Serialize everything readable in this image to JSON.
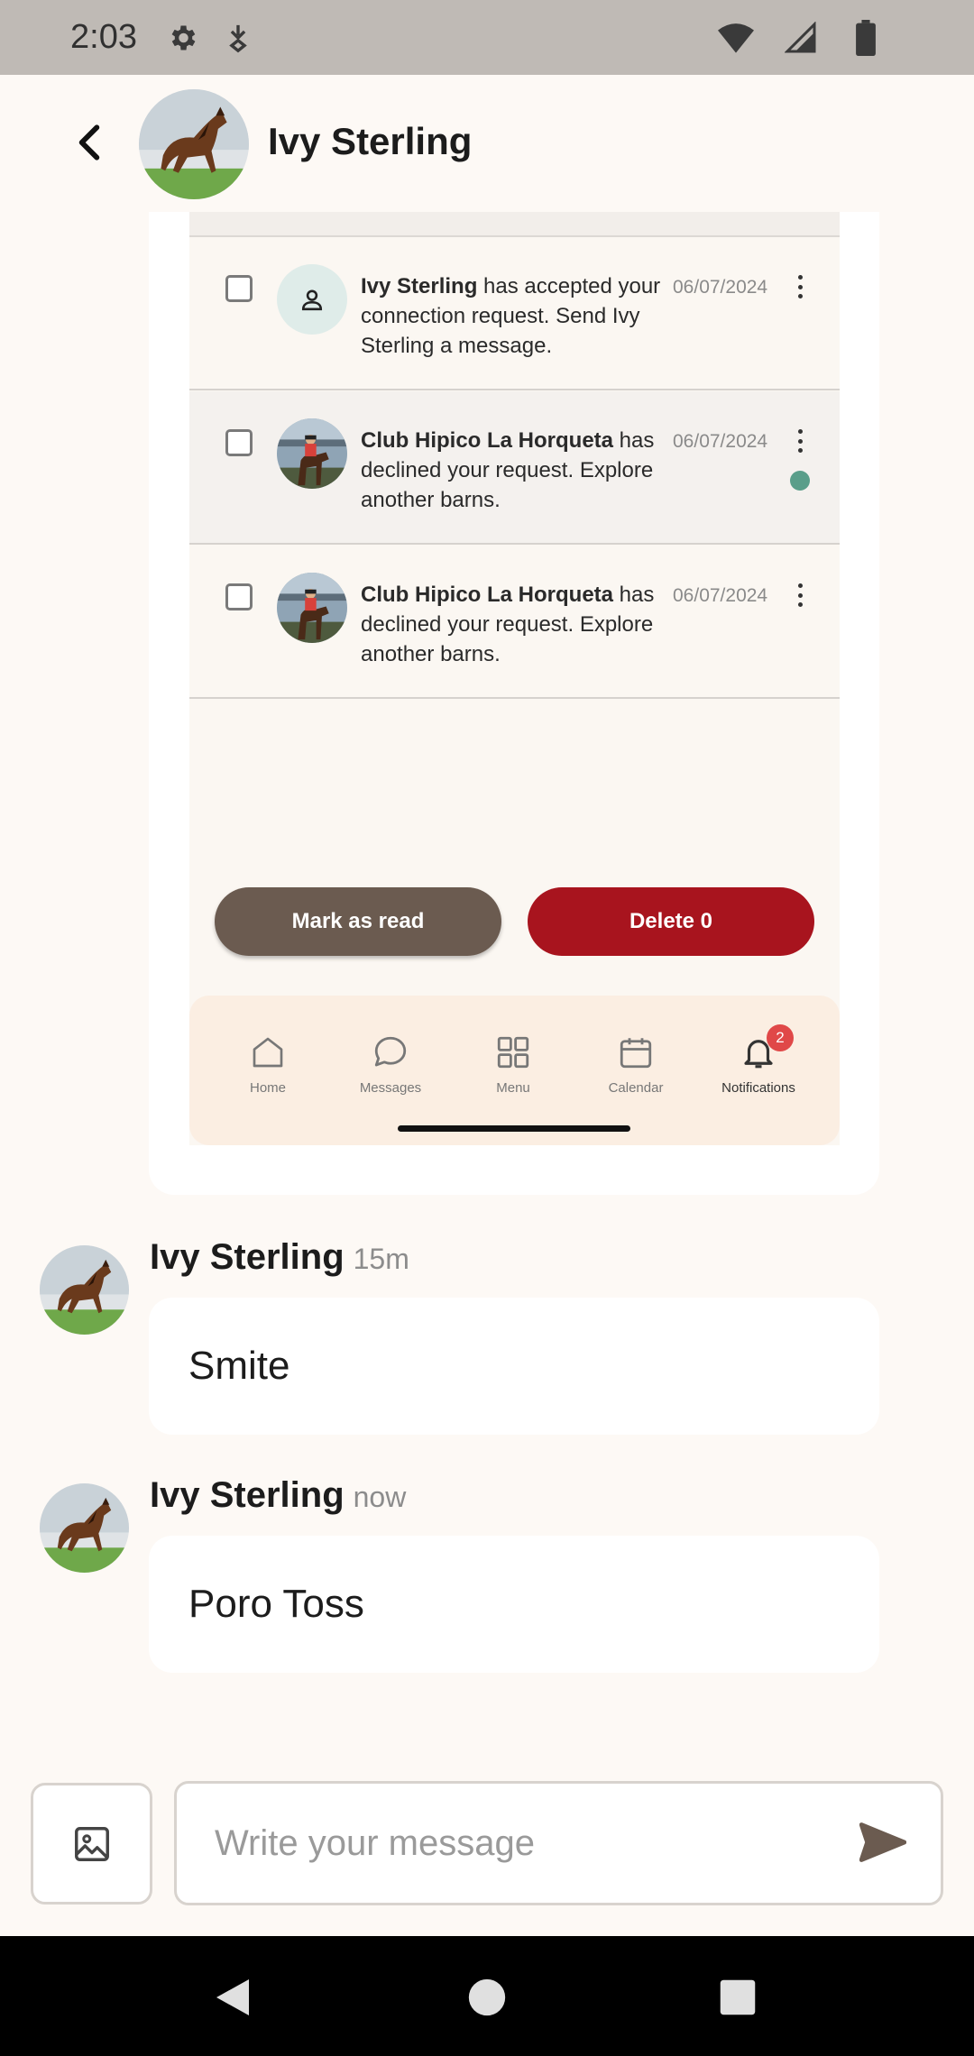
{
  "status_bar": {
    "time": "2:03",
    "icons": [
      "settings-icon",
      "download-icon",
      "wifi-icon",
      "signal-icon",
      "battery-icon"
    ]
  },
  "header": {
    "name": "Ivy Sterling",
    "back_icon": "arrow-back-icon"
  },
  "shared_screenshot": {
    "notifications": [
      {
        "sender": "Ivy Sterling",
        "text": " has accepted your connection request. Send Ivy Sterling a message.",
        "date": "06/07/2024",
        "unread": false,
        "avatar": "person-icon"
      },
      {
        "sender": "Club Hipico La Horqueta",
        "text": " has declined your request. Explore another barns.",
        "date": "06/07/2024",
        "unread": true,
        "avatar": "rider-photo"
      },
      {
        "sender": "Club Hipico La Horqueta",
        "text": " has declined your request. Explore another barns.",
        "date": "06/07/2024",
        "unread": false,
        "avatar": "rider-photo"
      }
    ],
    "buttons": {
      "mark_read": "Mark as read",
      "delete": "Delete 0"
    },
    "bottom_nav": [
      {
        "label": "Home",
        "icon": "home-icon"
      },
      {
        "label": "Messages",
        "icon": "chat-icon"
      },
      {
        "label": "Menu",
        "icon": "grid-icon"
      },
      {
        "label": "Calendar",
        "icon": "calendar-icon"
      },
      {
        "label": "Notifications",
        "icon": "bell-icon",
        "badge": "2",
        "active": true
      }
    ]
  },
  "messages": [
    {
      "sender": "Ivy Sterling",
      "time": "15m",
      "text": "Smite"
    },
    {
      "sender": "Ivy Sterling",
      "time": "now",
      "text": "Poro Toss"
    }
  ],
  "composer": {
    "placeholder": "Write your message",
    "value": ""
  },
  "colors": {
    "background": "#fdf9f5",
    "mark_read_button": "#6b5b50",
    "delete_button": "#a8141e",
    "unread_dot": "#5a9e8a",
    "badge": "#e04848"
  }
}
